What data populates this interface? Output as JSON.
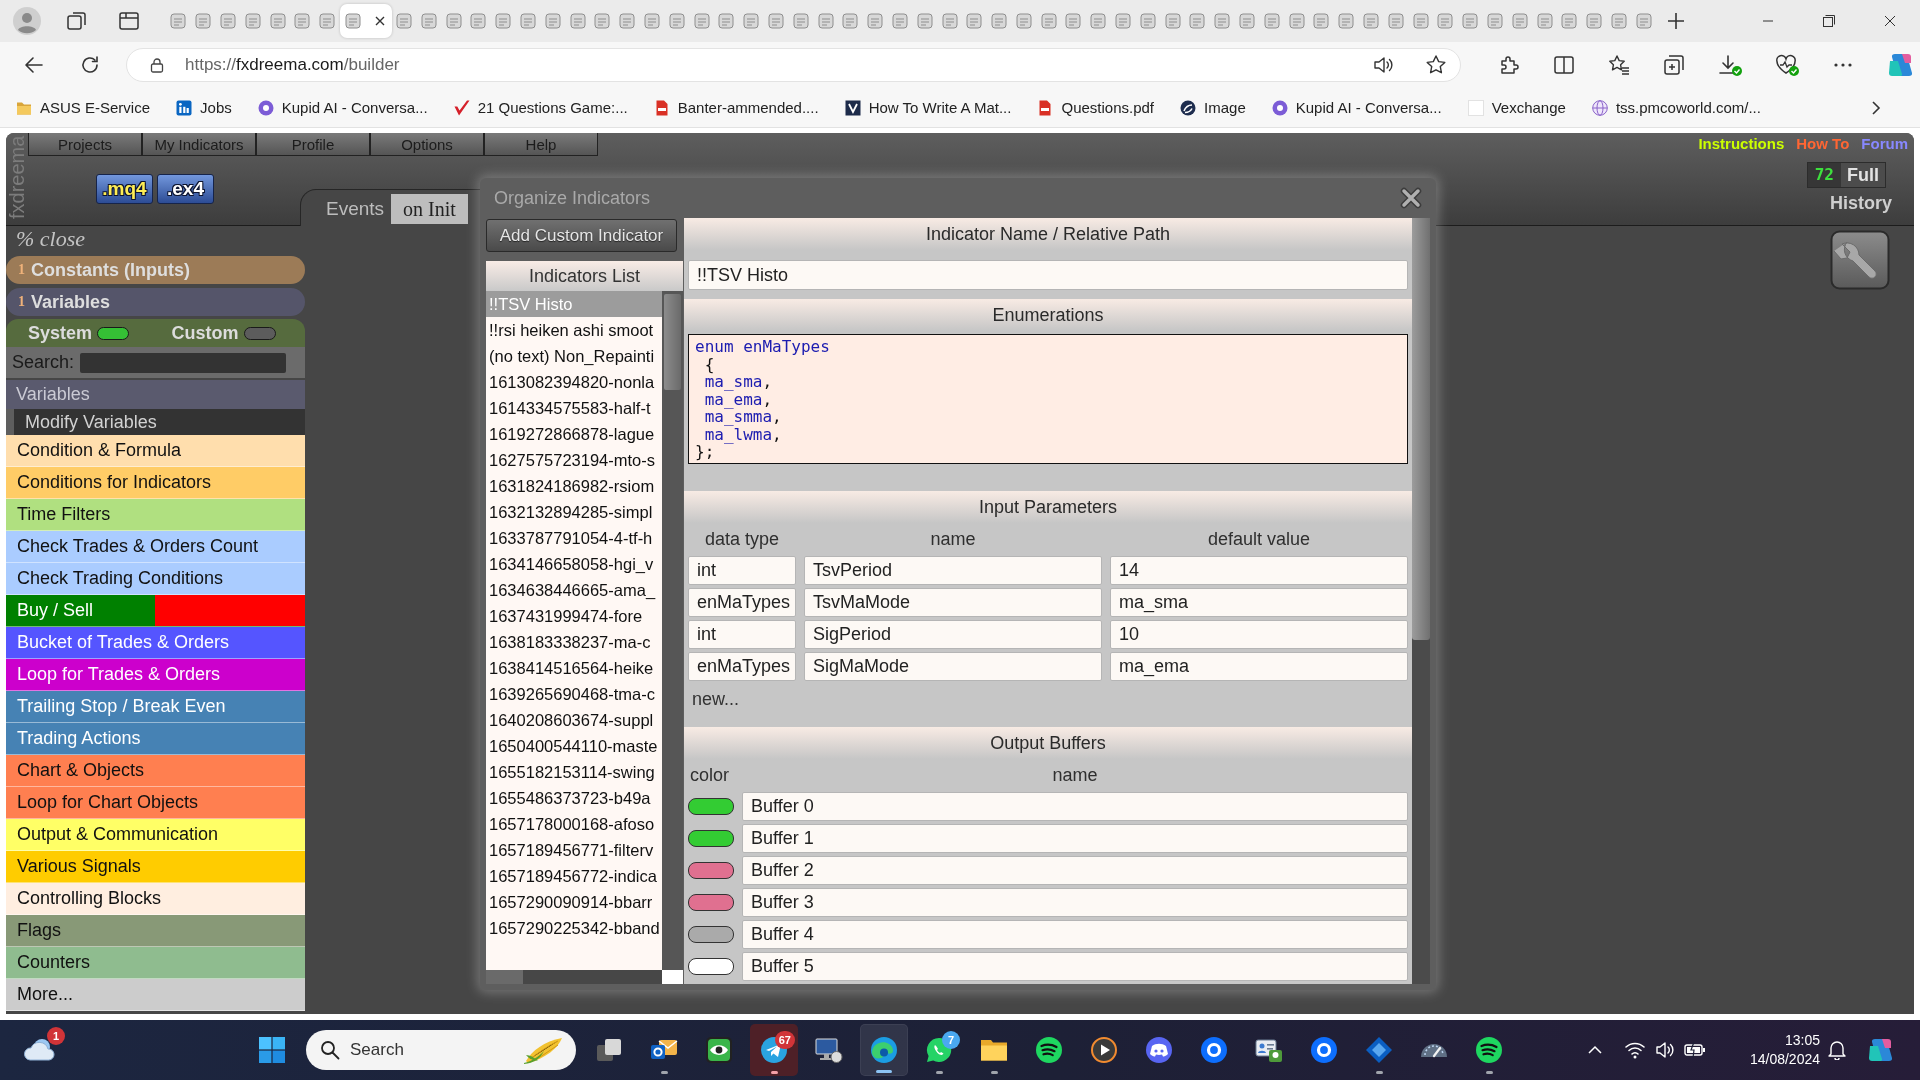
{
  "browser": {
    "tabs": [
      {
        "selected": false
      },
      {
        "selected": false
      },
      {
        "selected": false
      },
      {
        "selected": false
      },
      {
        "selected": false
      },
      {
        "selected": false
      },
      {
        "selected": false
      },
      {
        "selected": true
      },
      {
        "selected": false
      },
      {
        "selected": false
      },
      {
        "selected": false
      },
      {
        "selected": false
      },
      {
        "selected": false
      },
      {
        "selected": false
      },
      {
        "selected": false
      },
      {
        "selected": false
      },
      {
        "selected": false
      },
      {
        "selected": false
      },
      {
        "selected": false
      },
      {
        "selected": false
      },
      {
        "selected": false
      },
      {
        "selected": false
      },
      {
        "selected": false
      },
      {
        "selected": false
      },
      {
        "selected": false
      },
      {
        "selected": false
      },
      {
        "selected": false
      },
      {
        "selected": false
      },
      {
        "selected": false
      },
      {
        "selected": false
      },
      {
        "selected": false
      },
      {
        "selected": false
      },
      {
        "selected": false
      },
      {
        "selected": false
      },
      {
        "selected": false
      },
      {
        "selected": false
      },
      {
        "selected": false
      },
      {
        "selected": false
      },
      {
        "selected": false
      },
      {
        "selected": false
      },
      {
        "selected": false
      },
      {
        "selected": false
      },
      {
        "selected": false
      },
      {
        "selected": false
      },
      {
        "selected": false
      },
      {
        "selected": false
      },
      {
        "selected": false
      },
      {
        "selected": false
      },
      {
        "selected": false
      },
      {
        "selected": false
      },
      {
        "selected": false
      },
      {
        "selected": false
      },
      {
        "selected": false
      },
      {
        "selected": false
      },
      {
        "selected": false
      },
      {
        "selected": false
      },
      {
        "selected": false
      },
      {
        "selected": false
      },
      {
        "selected": false
      }
    ],
    "url": "https://fxdreema.com/builder",
    "bookmarks": [
      {
        "kind": "folder",
        "label": "ASUS E-Service"
      },
      {
        "kind": "tile",
        "label": "Jobs"
      },
      {
        "kind": "disc",
        "label": "Kupid AI - Conversa..."
      },
      {
        "kind": "tick",
        "label": "21 Questions Game:..."
      },
      {
        "kind": "pdf",
        "label": "Banter-ammended...."
      },
      {
        "kind": "chevron",
        "label": "How To Write A Mat..."
      },
      {
        "kind": "pdf",
        "label": "Questions.pdf"
      },
      {
        "kind": "swirl",
        "label": "Image"
      },
      {
        "kind": "disc",
        "label": "Kupid AI - Conversa..."
      },
      {
        "kind": "blank",
        "label": "Vexchange"
      },
      {
        "kind": "globe",
        "label": "tss.pmcoworld.com/..."
      }
    ]
  },
  "app": {
    "logo": "fxdreema",
    "menu": [
      "Projects",
      "My Indicators",
      "Profile",
      "Options",
      "Help"
    ],
    "file_buttons": [
      {
        "label": ".mq4",
        "selected": true
      },
      {
        "label": ".ex4",
        "selected": false
      }
    ],
    "events": {
      "label": "Events",
      "tabs": [
        {
          "label": "on Init",
          "selected": true
        }
      ]
    },
    "links": [
      {
        "label": "Instructions",
        "color": "#ccff00"
      },
      {
        "label": "How To",
        "color": "#ff6633"
      },
      {
        "label": "Forum",
        "color": "#8888ff"
      }
    ],
    "counter": {
      "value": "72",
      "label": "Full"
    },
    "history": "History"
  },
  "sidebar": {
    "close": "% close",
    "sections": [
      {
        "count": "1",
        "label": "Constants (Inputs)",
        "color": "#9c7b57"
      },
      {
        "count": "1",
        "label": "Variables",
        "color": "#55556a"
      }
    ],
    "toggles": [
      {
        "label": "System",
        "on": true
      },
      {
        "label": "Custom",
        "on": false
      }
    ],
    "search_label": "Search:",
    "group": {
      "title": "Variables",
      "items": [
        "Modify Variables"
      ]
    },
    "categories": [
      {
        "label": "Condition & Formula",
        "color": "#ffdead"
      },
      {
        "label": "Conditions for Indicators",
        "color": "#ffcc66"
      },
      {
        "label": "Time Filters",
        "color": "#b0e080"
      },
      {
        "label": "Check Trades & Orders Count",
        "color": "#aaccff"
      },
      {
        "label": "Check Trading Conditions",
        "color": "#aaccff"
      },
      {
        "label": "Buy / Sell",
        "color": "#008000",
        "right": {
          "color": "#ff0000"
        }
      },
      {
        "label": "Bucket of Trades & Orders",
        "color": "#5555ff"
      },
      {
        "label": "Loop for Trades & Orders",
        "color": "#cc00cc"
      },
      {
        "label": "Trailing Stop / Break Even",
        "color": "#4682b4"
      },
      {
        "label": "Trading Actions",
        "color": "#4682b4"
      },
      {
        "label": "Chart & Objects",
        "color": "#ff7f50"
      },
      {
        "label": "Loop for Chart Objects",
        "color": "#ff7f50"
      },
      {
        "label": "Output & Communication",
        "color": "#ffff66"
      },
      {
        "label": "Various Signals",
        "color": "#ffcc00"
      },
      {
        "label": "Controlling Blocks",
        "color": "#ffeee0"
      },
      {
        "label": "Flags",
        "color": "#889977"
      },
      {
        "label": "Counters",
        "color": "#8fbc8f"
      },
      {
        "label": "More...",
        "color": "#cccccc"
      }
    ]
  },
  "dialog": {
    "title": "Organize Indicators",
    "add_button": "Add Custom Indicator",
    "list": {
      "title": "Indicators List",
      "items": [
        {
          "label": "!!TSV Histo",
          "selected": true
        },
        {
          "label": "!!rsi heiken ashi smoot",
          "selected": false
        },
        {
          "label": "(no text) Non_Repainti",
          "selected": false
        },
        {
          "label": "1613082394820-nonla",
          "selected": false
        },
        {
          "label": "1614334575583-half-t",
          "selected": false
        },
        {
          "label": "1619272866878-lague",
          "selected": false
        },
        {
          "label": "1627575723194-mto-s",
          "selected": false
        },
        {
          "label": "1631824186982-rsiom",
          "selected": false
        },
        {
          "label": "1632132894285-simpl",
          "selected": false
        },
        {
          "label": "1633787791054-4-tf-h",
          "selected": false
        },
        {
          "label": "1634146658058-hgi_v",
          "selected": false
        },
        {
          "label": "1634638446665-ama_",
          "selected": false
        },
        {
          "label": "1637431999474-fore",
          "selected": false
        },
        {
          "label": "1638183338237-ma-c",
          "selected": false
        },
        {
          "label": "1638414516564-heike",
          "selected": false
        },
        {
          "label": "1639265690468-tma-c",
          "selected": false
        },
        {
          "label": "1640208603674-suppl",
          "selected": false
        },
        {
          "label": "1650400544110-maste",
          "selected": false
        },
        {
          "label": "1655182153114-swing",
          "selected": false
        },
        {
          "label": "1655486373723-b49a",
          "selected": false
        },
        {
          "label": "1657178000168-afoso",
          "selected": false
        },
        {
          "label": "1657189456771-filterv",
          "selected": false
        },
        {
          "label": "1657189456772-indica",
          "selected": false
        },
        {
          "label": "1657290090914-bbarr",
          "selected": false
        },
        {
          "label": "1657290225342-bband",
          "selected": false
        }
      ]
    },
    "name_section": {
      "title": "Indicator Name / Relative Path",
      "value": "!!TSV Histo"
    },
    "enumerations": {
      "title": "Enumerations",
      "code": [
        "enum enMaTypes",
        " {",
        " ma_sma,",
        " ma_ema,",
        " ma_smma,",
        " ma_lwma,",
        "};"
      ]
    },
    "inputs": {
      "title": "Input Parameters",
      "columns": [
        "data type",
        "name",
        "default value"
      ],
      "rows": [
        {
          "data_type": "int",
          "name": "TsvPeriod",
          "default": "14"
        },
        {
          "data_type": "enMaTypes",
          "name": "TsvMaMode",
          "default": "ma_sma"
        },
        {
          "data_type": "int",
          "name": "SigPeriod",
          "default": "10"
        },
        {
          "data_type": "enMaTypes",
          "name": "SigMaMode",
          "default": "ma_ema"
        }
      ],
      "add": "new..."
    },
    "buffers": {
      "title": "Output Buffers",
      "columns": [
        "color",
        "name"
      ],
      "rows": [
        {
          "color": "#33cc33",
          "name": "Buffer 0"
        },
        {
          "color": "#33cc33",
          "name": "Buffer 1"
        },
        {
          "color": "#e07090",
          "name": "Buffer 2"
        },
        {
          "color": "#e07090",
          "name": "Buffer 3"
        },
        {
          "color": "#aaaaaa",
          "name": "Buffer 4"
        },
        {
          "color": "#ffffff",
          "name": "Buffer 5"
        }
      ]
    }
  },
  "taskbar": {
    "weather": {
      "badge": "1"
    },
    "search": {
      "placeholder": "Search"
    },
    "apps": [
      {
        "kind": "task-view",
        "running": false,
        "selected": false,
        "flashing": false
      },
      {
        "kind": "mail",
        "running": true,
        "selected": false,
        "flashing": false
      },
      {
        "kind": "eye",
        "running": false,
        "selected": false,
        "flashing": false
      },
      {
        "kind": "telegram",
        "running": true,
        "selected": false,
        "flashing": true,
        "badge": "67"
      },
      {
        "kind": "monitor",
        "running": false,
        "selected": false,
        "flashing": false
      },
      {
        "kind": "edge",
        "running": true,
        "selected": true,
        "flashing": false
      },
      {
        "kind": "whatsapp",
        "running": true,
        "selected": false,
        "flashing": false,
        "badge": "7"
      },
      {
        "kind": "folder",
        "running": true,
        "selected": false,
        "flashing": false
      },
      {
        "kind": "spotify",
        "running": false,
        "selected": false,
        "flashing": false
      },
      {
        "kind": "play",
        "running": false,
        "selected": false,
        "flashing": false
      },
      {
        "kind": "discord",
        "running": false,
        "selected": false,
        "flashing": false
      },
      {
        "kind": "p-app",
        "running": false,
        "selected": false,
        "flashing": false
      },
      {
        "kind": "contacts",
        "running": false,
        "selected": false,
        "flashing": false
      },
      {
        "kind": "p-app",
        "running": false,
        "selected": false,
        "flashing": false
      },
      {
        "kind": "diamond",
        "running": true,
        "selected": false,
        "flashing": false
      },
      {
        "kind": "gauge",
        "running": false,
        "selected": false,
        "flashing": false
      },
      {
        "kind": "spotify",
        "running": true,
        "selected": false,
        "flashing": false
      }
    ],
    "clock": {
      "time": "13:05",
      "date": "14/08/2024"
    }
  }
}
